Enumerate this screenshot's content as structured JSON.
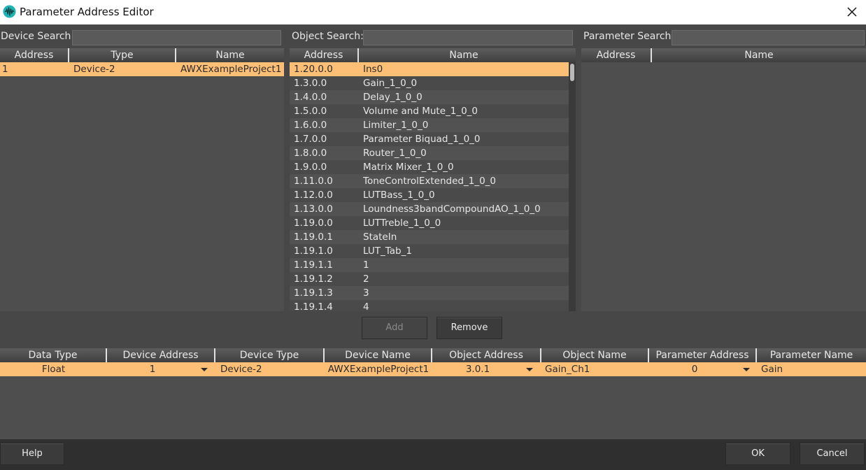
{
  "window": {
    "title": "Parameter Address Editor"
  },
  "search": {
    "device_label": "Device Search:",
    "object_label": "Object Search:",
    "parameter_label": "Parameter Search:",
    "device_value": "",
    "object_value": "",
    "parameter_value": ""
  },
  "device_grid": {
    "headers": [
      "Address",
      "Type",
      "Name"
    ],
    "rows": [
      {
        "address": "1",
        "type": "Device-2",
        "name": "AWXExampleProject1",
        "selected": true
      }
    ]
  },
  "object_grid": {
    "headers": [
      "Address",
      "Name"
    ],
    "rows": [
      {
        "address": "1.20.0.0",
        "name": "Ins0",
        "selected": true
      },
      {
        "address": "1.3.0.0",
        "name": "Gain_1_0_0"
      },
      {
        "address": "1.4.0.0",
        "name": "Delay_1_0_0"
      },
      {
        "address": "1.5.0.0",
        "name": "Volume and Mute_1_0_0"
      },
      {
        "address": "1.6.0.0",
        "name": "Limiter_1_0_0"
      },
      {
        "address": "1.7.0.0",
        "name": "Parameter Biquad_1_0_0"
      },
      {
        "address": "1.8.0.0",
        "name": "Router_1_0_0"
      },
      {
        "address": "1.9.0.0",
        "name": "Matrix Mixer_1_0_0"
      },
      {
        "address": "1.11.0.0",
        "name": "ToneControlExtended_1_0_0"
      },
      {
        "address": "1.12.0.0",
        "name": "LUTBass_1_0_0"
      },
      {
        "address": "1.13.0.0",
        "name": "Loundness3bandCompoundAO_1_0_0"
      },
      {
        "address": "1.19.0.0",
        "name": "LUTTreble_1_0_0"
      },
      {
        "address": "1.19.0.1",
        "name": "StateIn"
      },
      {
        "address": "1.19.1.0",
        "name": "LUT_Tab_1"
      },
      {
        "address": "1.19.1.1",
        "name": "1"
      },
      {
        "address": "1.19.1.2",
        "name": "2"
      },
      {
        "address": "1.19.1.3",
        "name": "3"
      },
      {
        "address": "1.19.1.4",
        "name": "4"
      }
    ]
  },
  "parameter_grid": {
    "headers": [
      "Address",
      "Name"
    ],
    "rows": []
  },
  "actions": {
    "add_label": "Add",
    "remove_label": "Remove"
  },
  "mapping_grid": {
    "headers": [
      "Data Type",
      "Device Address",
      "Device Type",
      "Device Name",
      "Object Address",
      "Object Name",
      "Parameter Address",
      "Parameter Name"
    ],
    "rows": [
      {
        "data_type": "Float",
        "device_address": "1",
        "device_type": "Device-2",
        "device_name": "AWXExampleProject1",
        "object_address": "3.0.1",
        "object_name": "Gain_Ch1",
        "parameter_address": "0",
        "parameter_name": "Gain",
        "selected": true
      }
    ]
  },
  "footer": {
    "help_label": "Help",
    "ok_label": "OK",
    "cancel_label": "Cancel"
  },
  "colors": {
    "selection": "#fdbf75",
    "background": "#474747",
    "grid": "#4e4e4e",
    "footer": "#2f2f2f",
    "accent_icon": "#1fb3b3"
  }
}
